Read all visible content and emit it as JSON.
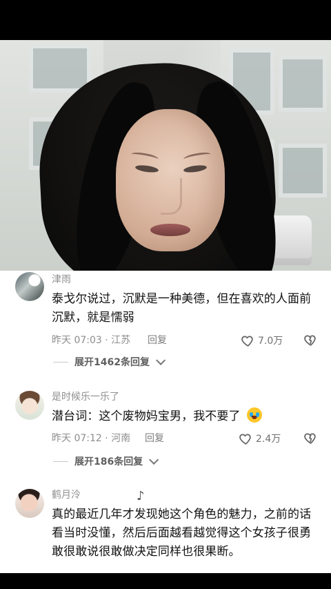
{
  "comments": [
    {
      "username": "津雨",
      "text": "泰戈尔说过，沉默是一种美德，但在喜欢的人面前沉默，就是懦弱",
      "time_location": "昨天 07:03 · 江苏",
      "reply": "回复",
      "likes": "7.0万",
      "expand": "展开1462条回复"
    },
    {
      "username": "是时候乐一乐了",
      "text": "潜台词：这个废物妈宝男，我不要了",
      "time_location": "昨天 07:12 · 河南",
      "reply": "回复",
      "likes": "2.4万",
      "expand": "展开186条回复"
    },
    {
      "username": "鹤月泠",
      "text": "真的最近几年才发现她这个角色的魅力，之前的话看当时没懂，然后后面越看越觉得这个女孩子很勇敢很敢说很敢做决定同样也很果断。"
    }
  ],
  "icons": {
    "like": "heart-outline-icon",
    "dislike": "broken-heart-outline-icon",
    "expand": "chevron-down-icon",
    "emoji": "crying-face-emoji",
    "music_note": "music-note-icon"
  },
  "colors": {
    "background": "#000000",
    "comment_background": "#ffffff",
    "secondary_text": "#8f8f8f",
    "primary_text": "#121212"
  }
}
